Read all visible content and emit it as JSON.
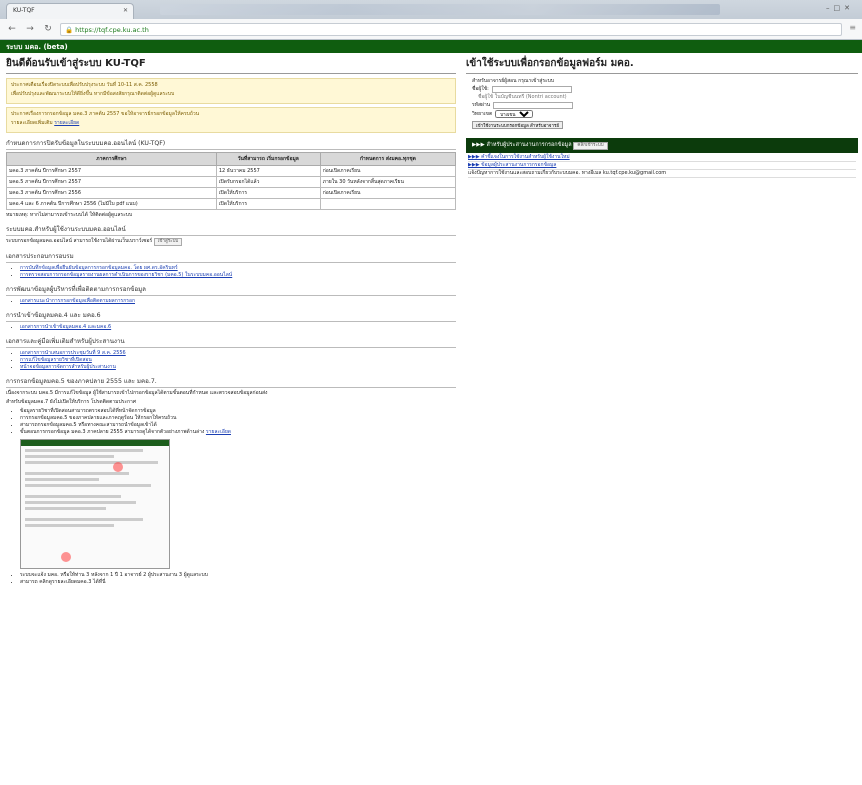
{
  "browser": {
    "tab_title": "KU-TQF",
    "url": "https://tqf.cpe.ku.ac.th"
  },
  "topbar": {
    "title": "ระบบ มคอ. (beta)"
  },
  "left": {
    "title": "ยินดีต้อนรับเข้าสู่ระบบ KU-TQF",
    "note1": [
      "ประกาศเตือนเรื่องปิดระบบเพื่อปรับปรุงระบบ วันที่ 10-11 ส.ค. 2558",
      "เพื่อปรับปรุงและพัฒนาระบบให้ดียิ่งขึ้น หากมีข้อสงสัยกรุณาติดต่อผู้ดูแลระบบ"
    ],
    "note2": [
      "ประกาศเรื่องการกรอกข้อมูล มคอ.3 ภาคต้น 2557 ขอให้อาจารย์กรอกข้อมูลให้ครบถ้วน",
      "รายละเอียดเพิ่มเติม"
    ],
    "note2_link": "รายละเอียด",
    "sched_title": "กำหนดการการปิดรับข้อมูลในระบบมคอ.ออนไลน์ (KU-TQF)",
    "sched_headers": [
      "ภาคการศึกษา",
      "วันที่สามารถ เริ่มกรอกข้อมูล",
      "กำหนดการ ส่งมคอ.ทุกชุด"
    ],
    "sched_rows": [
      [
        "มคอ.3 ภาคต้น ปีการศึกษา 2557",
        "12 ธันวาคม 2557",
        "ก่อนเปิดภาคเรียน"
      ],
      [
        "มคอ.5 ภาคต้น ปีการศึกษา 2557",
        "เปิดรับกรอกได้แล้ว",
        "ภายใน 30 วันหลังจากสิ้นสุดภาคเรียน"
      ],
      [
        "มคอ.3 ภาคต้น ปีการศึกษา 2556",
        "เปิดให้บริการ",
        "ก่อนเปิดภาคเรียน"
      ],
      [
        "มคอ.4 และ 6 ภาคต้น ปีการศึกษา 2556 (ไม่มีใบ pdf แนบ)",
        "เปิดให้บริการ",
        ""
      ]
    ],
    "sched_note": "หมายเหตุ: หากไม่สามารถเข้าระบบได้ ให้ติดต่อผู้ดูแลระบบ",
    "s1": "ระบบมคอ.สำหรับผู้ใช้งานระบบมคอ.ออนไลน์",
    "s1_text": "ระบบกรอกข้อมูลมคอ.ออนไลน์ สามารถใช้งานได้ผ่านเว็บเบราว์เซอร์",
    "s1_btn": "เข้าสู่ระบบ",
    "s2": "เอกสารประกอบการอบรม",
    "s2_items": [
      "การบันทึกข้อมูลเพื่อยืนยันข้อมูลการกรอกข้อมูลมคอ. โดย ผศ.ดร.อัครินทร์",
      "การตรวจสอบการกรอกข้อมูลรายงานผลการดำเนินการของรายวิชา (มคอ.5) ในระบบมคอ.ออนไลน์"
    ],
    "s3": "การพัฒนาข้อมูลผู้บริหารที่เพื่อติดตามการกรอกข้อมูล",
    "s3_items": [
      "เอกสารแนะนำการกรอกข้อมูลเพื่อติดตามผลการกรอก"
    ],
    "s4": "การนำเข้าข้อมูลมคอ.4 และ มคอ.6",
    "s4_items": [
      "เอกสารการนำเข้าข้อมูลมคอ.4 และมคอ.6"
    ],
    "s5": "เอกสารและคู่มือเพิ่มเติมสำหรับผู้ประสานงาน",
    "s5_items": [
      "เอกสารการนำเสนอการประชุมวันที่ 9 ส.ค. 2556",
      "การแก้ไขข้อมูลรายวิชาที่เปิดสอน",
      "หน้าจอข้อมูลการจัดการสำหรับผู้ประสานงาน"
    ],
    "s6": "การกรอกข้อมูลมคอ.5 ของภาคปลาย 2555 และ มคอ.7.",
    "s6_text": "เนื่องจากระบบ มคอ.5 มีการแก้ไขข้อมูล ผู้ใช้สามารถเข้าไปกรอกข้อมูลได้ตามขั้นตอนที่กำหนด และตรวจสอบข้อมูลก่อนส่ง",
    "s6_text2": "สำหรับข้อมูลมคอ.7 ยังไม่เปิดให้บริการ โปรดติดตามประกาศ",
    "s6_items": [
      "ข้อมูลรายวิชาที่เปิดสอนสามารถตรวจสอบได้ที่หน้าจัดการข้อมูล",
      "การกรอกข้อมูลมคอ.5 ของภาคปลายและภาคฤดูร้อน ให้กรอกให้ครบถ้วน",
      "สามารถกรอกข้อมูลมคอ.5 หรือทางคณะสามารถนำข้อมูลเข้าได้",
      "ขั้นตอนการกรอกข้อมูล มคอ.3 ภาคปลาย 2555 สามารถดูได้จากตัวอย่างภาพด้านล่าง"
    ],
    "s6_link": "รายละเอียด",
    "s6_tail": [
      "ระบบจะแจ้ง มคอ. หรือให้ท่าน 3 หลังจาก 1 ปี 1 อาจารย์ 2 ผู้ประสานงาน 3 ผู้ดูแลระบบ",
      "สามารถ คลิกดูรายละเอียดมคอ.3 ได้ที่นี่"
    ]
  },
  "right": {
    "title": "เข้าใช้ระบบเพื่อกรอกข้อมูลฟอร์ม มคอ.",
    "intro": "สำหรับอาจารย์ผู้สอน กรุณาเข้าสู่ระบบ",
    "user_label": "ชื่อผู้ใช้:",
    "user_hint": "ชื่อผู้ใช้ ในบัญชีนนทรี (Nontri account)",
    "pass_label": "รหัสผ่าน",
    "role_label": "วิทยาเขต",
    "role_value": "บางเขน",
    "login_btn": "เข้าใช้งานระบบกรอกข้อมูล สำหรับอาจารย์",
    "green": "▶▶▶ สำหรับผู้ประสานงานการกรอกข้อมูล",
    "green_btn": "คลิกเข้าระบบ",
    "links": [
      "▶▶▶ คำชี้แจงในการใช้งานสำหรับผู้ใช้งานใหม่",
      "▶▶▶ ข้อมูลผู้ประสานงานการกรอกข้อมูล",
      "แจ้งปัญหาการใช้งานและสอบถามเกี่ยวกับระบบมคอ. ทางอีเมล ku.tqf.cpe.ku@gmail.com"
    ]
  }
}
